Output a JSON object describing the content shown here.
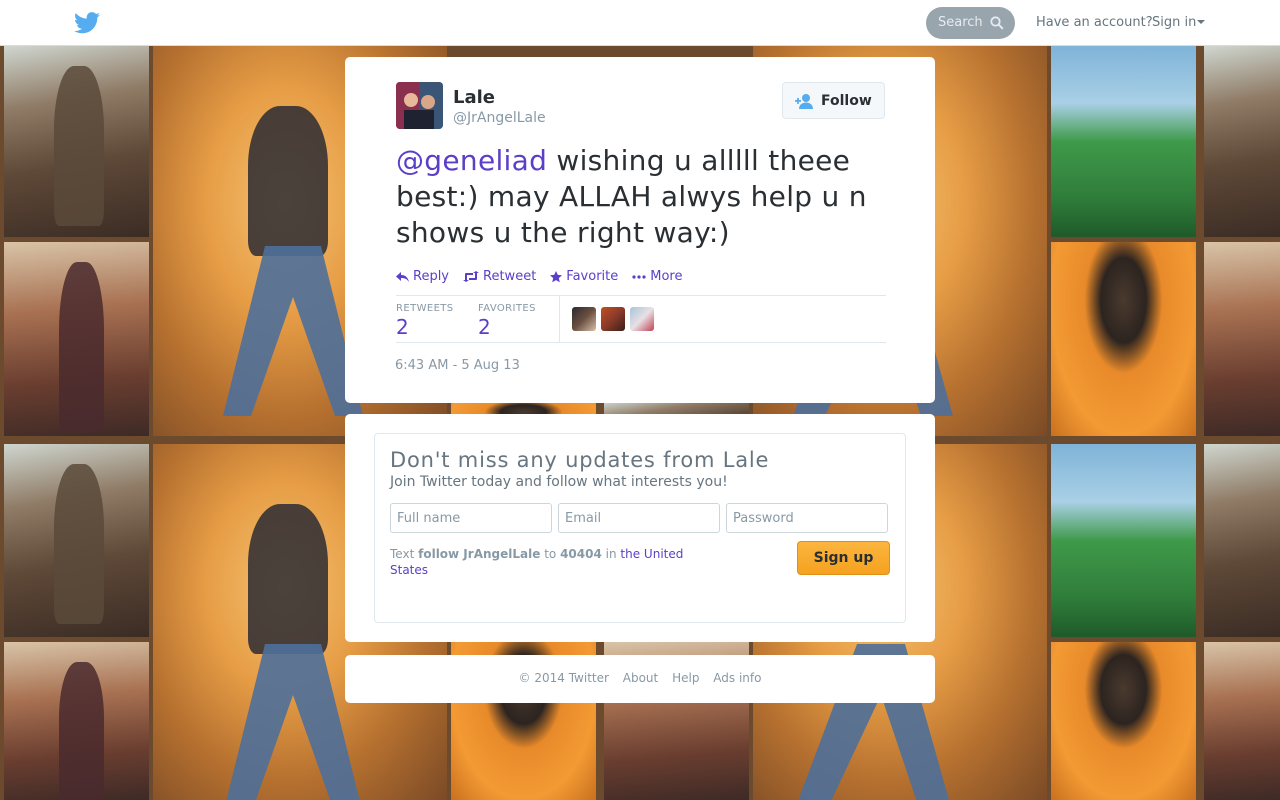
{
  "header": {
    "logo": "twitter-bird-icon",
    "search_placeholder": "Search",
    "have_account": "Have an account?",
    "signin_label": "Sign in"
  },
  "tweet": {
    "author_name": "Lale",
    "author_handle": "@JrAngelLale",
    "follow_label": "Follow",
    "text_mention": "@geneliad",
    "text_body": " wishing u alllll theee best:) may ALLAH alwys help u n shows u the right way:)",
    "actions": {
      "reply": "Reply",
      "retweet": "Retweet",
      "favorite": "Favorite",
      "more": "More"
    },
    "stats": {
      "retweets_label": "RETWEETS",
      "retweets_count": "2",
      "favorites_label": "FAVORITES",
      "favorites_count": "2"
    },
    "timestamp": "6:43 AM - 5 Aug 13"
  },
  "signup": {
    "title": "Don't miss any updates from Lale",
    "subtitle": "Join Twitter today and follow what interests you!",
    "fullname_placeholder": "Full name",
    "email_placeholder": "Email",
    "password_placeholder": "Password",
    "text_prefix": "Text",
    "text_command": "follow JrAngelLale",
    "text_to": "to",
    "text_number": "40404",
    "text_in": "in",
    "text_country": "the United States",
    "button_label": "Sign up"
  },
  "footer": {
    "copyright": "© 2014 Twitter",
    "about": "About",
    "help": "Help",
    "ads_info": "Ads info"
  },
  "colors": {
    "link": "#5b3fc8",
    "signup_button": "#f5a21f",
    "twitter_blue": "#55acee"
  }
}
